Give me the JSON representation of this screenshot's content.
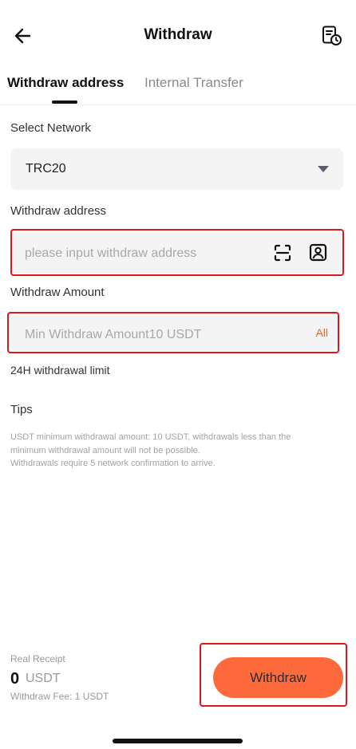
{
  "header": {
    "title": "Withdraw"
  },
  "tabs": [
    {
      "label": "Withdraw address",
      "active": true
    },
    {
      "label": "Internal Transfer",
      "active": false
    }
  ],
  "network": {
    "label": "Select Network",
    "value": "TRC20"
  },
  "address": {
    "label": "Withdraw address",
    "placeholder": "please input withdraw address"
  },
  "amount": {
    "label": "Withdraw Amount",
    "placeholder": "Min Withdraw Amount10 USDT",
    "all_label": "All"
  },
  "limit": {
    "label": "24H withdrawal limit"
  },
  "tips": {
    "title": "Tips",
    "text": "USDT minimum withdrawal amount: 10 USDT, withdrawals less than the\nminimum withdrawal amount will not be possible.\nWithdrawals require 5 network confirmation to arrive."
  },
  "receipt": {
    "label": "Real Receipt",
    "amount": "0",
    "unit": "USDT",
    "fee": "Withdraw Fee: 1 USDT"
  },
  "actions": {
    "withdraw_label": "Withdraw"
  },
  "colors": {
    "accent": "#ff6a3d",
    "highlight": "#e0161e",
    "field_bg": "#f4f4f4"
  },
  "icons": {
    "back": "arrow-left-icon",
    "record": "withdraw-record-icon",
    "scan": "scan-icon",
    "contacts": "address-book-icon",
    "dropdown": "caret-down-icon"
  }
}
